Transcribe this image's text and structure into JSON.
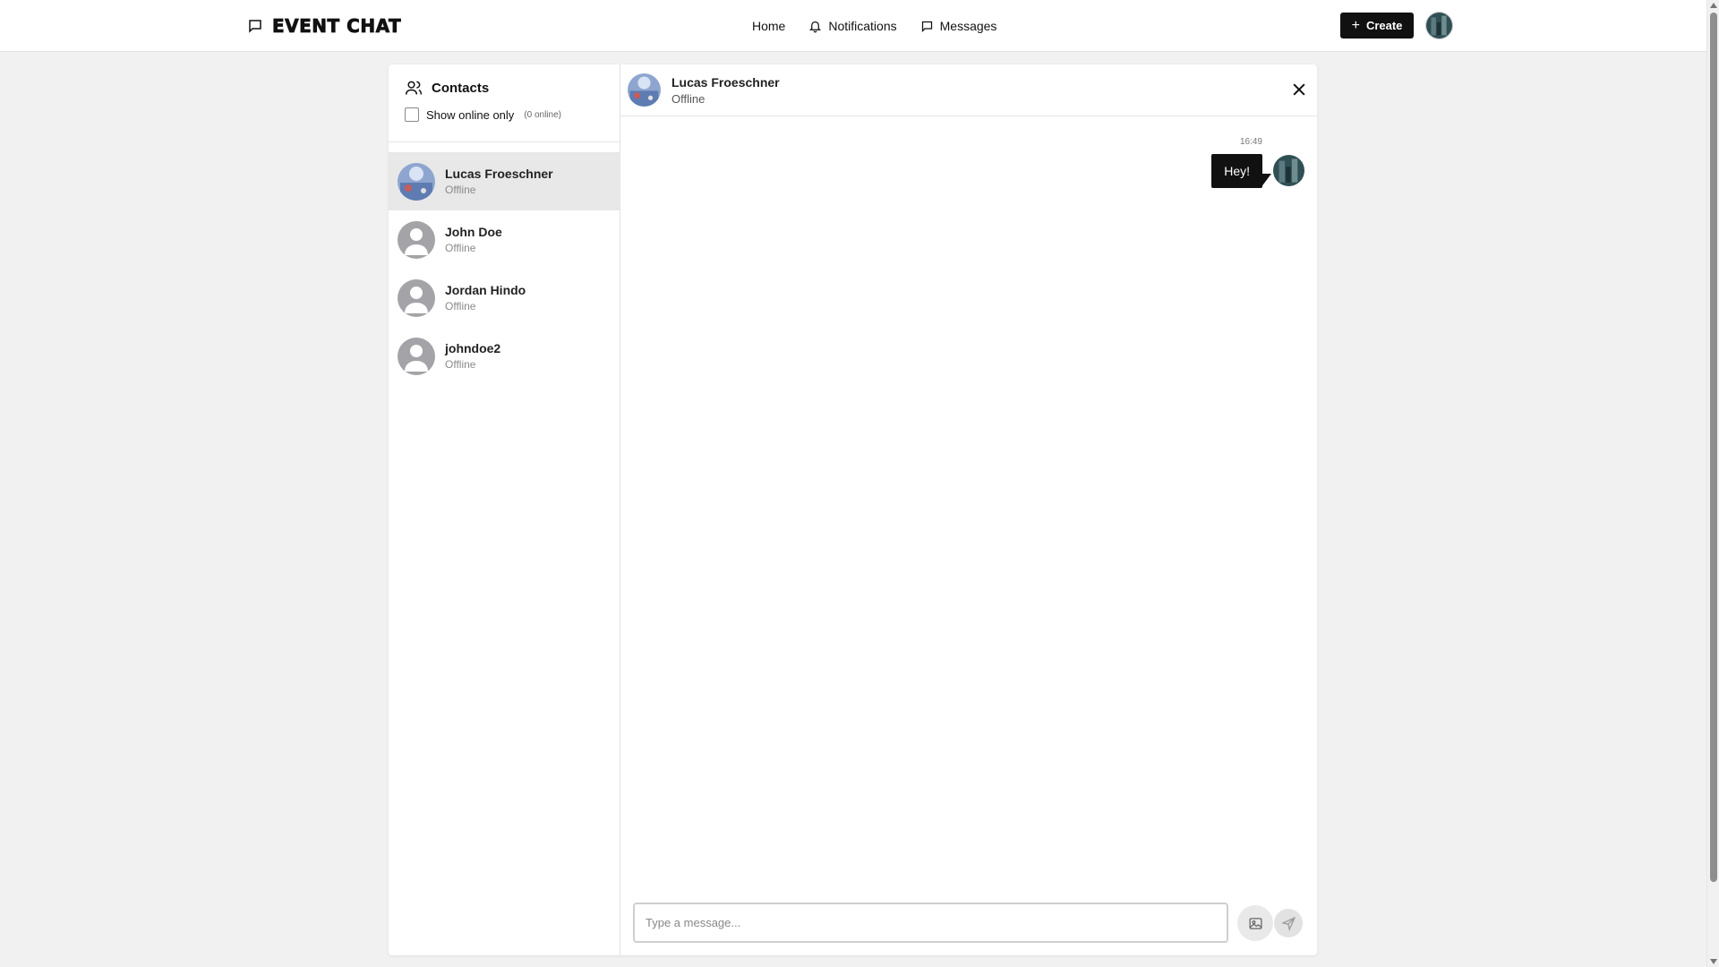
{
  "nav": {
    "brand": "EVENT CHAT",
    "home": "Home",
    "notifications": "Notifications",
    "messages": "Messages",
    "create": "Create"
  },
  "sidebar": {
    "title": "Contacts",
    "filter_label": "Show online only",
    "online_count": "(0 online)",
    "contacts": [
      {
        "name": "Lucas Froeschner",
        "status": "Offline"
      },
      {
        "name": "John Doe",
        "status": "Offline"
      },
      {
        "name": "Jordan Hindo",
        "status": "Offline"
      },
      {
        "name": "johndoe2",
        "status": "Offline"
      }
    ]
  },
  "chat": {
    "name": "Lucas Froeschner",
    "status": "Offline",
    "message_time": "16:49",
    "message_text": "Hey!",
    "input_placeholder": "Type a message..."
  },
  "colors": {
    "accent": "#111111",
    "active_contact": "#e8e8e8",
    "background": "#f1f1f1"
  }
}
